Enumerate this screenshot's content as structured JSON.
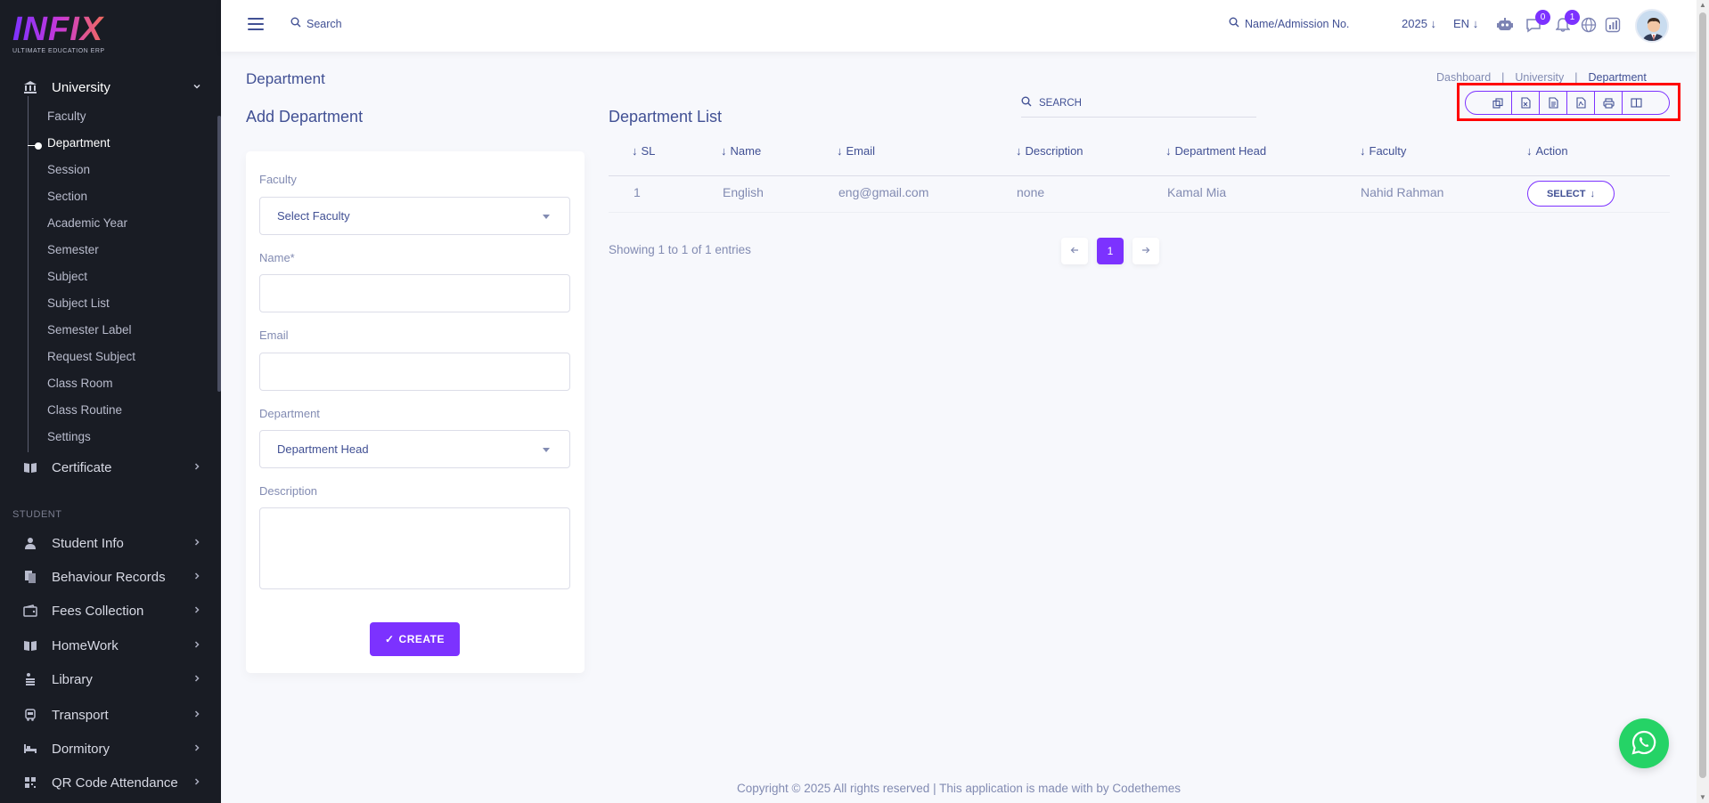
{
  "sidebar": {
    "logo": {
      "main": "INFIX",
      "sub": "ULTIMATE EDUCATION ERP"
    },
    "university": {
      "label": "University",
      "icon": "bank-icon"
    },
    "sub_items": [
      "Faculty",
      "Department",
      "Session",
      "Section",
      "Academic Year",
      "Semester",
      "Subject",
      "Subject List",
      "Semester Label",
      "Request Subject",
      "Class Room",
      "Class Routine",
      "Settings"
    ],
    "active_sub": "Department",
    "certificate": {
      "label": "Certificate",
      "icon": "book-open-icon"
    },
    "section_label": "STUDENT",
    "groups": [
      {
        "label": "Student Info",
        "icon": "user-icon"
      },
      {
        "label": "Behaviour Records",
        "icon": "records-icon"
      },
      {
        "label": "Fees Collection",
        "icon": "wallet-icon"
      },
      {
        "label": "HomeWork",
        "icon": "book-open-icon"
      },
      {
        "label": "Library",
        "icon": "library-icon"
      },
      {
        "label": "Transport",
        "icon": "bus-icon"
      },
      {
        "label": "Dormitory",
        "icon": "bed-icon"
      },
      {
        "label": "QR Code Attendance",
        "icon": "qr-icon"
      }
    ]
  },
  "topbar": {
    "search_label": "Search",
    "admission_search": "Name/Admission No.",
    "year": "2025",
    "language": "EN",
    "chat_badge": "0",
    "notification_badge": "1"
  },
  "page": {
    "title": "Department",
    "breadcrumb": [
      "Dashboard",
      "University",
      "Department"
    ]
  },
  "form": {
    "heading": "Add Department",
    "faculty_label": "Faculty",
    "faculty_placeholder": "Select Faculty",
    "name_label": "Name*",
    "name_value": "",
    "email_label": "Email",
    "email_value": "",
    "department_label": "Department",
    "department_placeholder": "Department Head",
    "description_label": "Description",
    "description_value": "",
    "create_button": "CREATE"
  },
  "list": {
    "heading": "Department List",
    "search_placeholder": "SEARCH",
    "columns": [
      "SL",
      "Name",
      "Email",
      "Description",
      "Department Head",
      "Faculty",
      "Action"
    ],
    "rows": [
      {
        "sl": "1",
        "name": "English",
        "email": "eng@gmail.com",
        "description": "none",
        "head": "Kamal Mia",
        "faculty": "Nahid Rahman",
        "action": "SELECT"
      }
    ],
    "showing": "Showing 1 to 1 of 1 entries",
    "current_page": "1",
    "export_buttons": [
      "copy-icon",
      "excel-icon",
      "csv-icon",
      "pdf-icon",
      "print-icon",
      "columns-icon"
    ]
  },
  "footer": {
    "text": "Copyright © 2025 All rights reserved | This application is made with by Codethemes"
  },
  "colors": {
    "accent": "#7c32ff",
    "sidebar_bg": "#191c24",
    "text": "#415094",
    "highlight_box": "#ff0000",
    "whatsapp": "#25d366"
  }
}
